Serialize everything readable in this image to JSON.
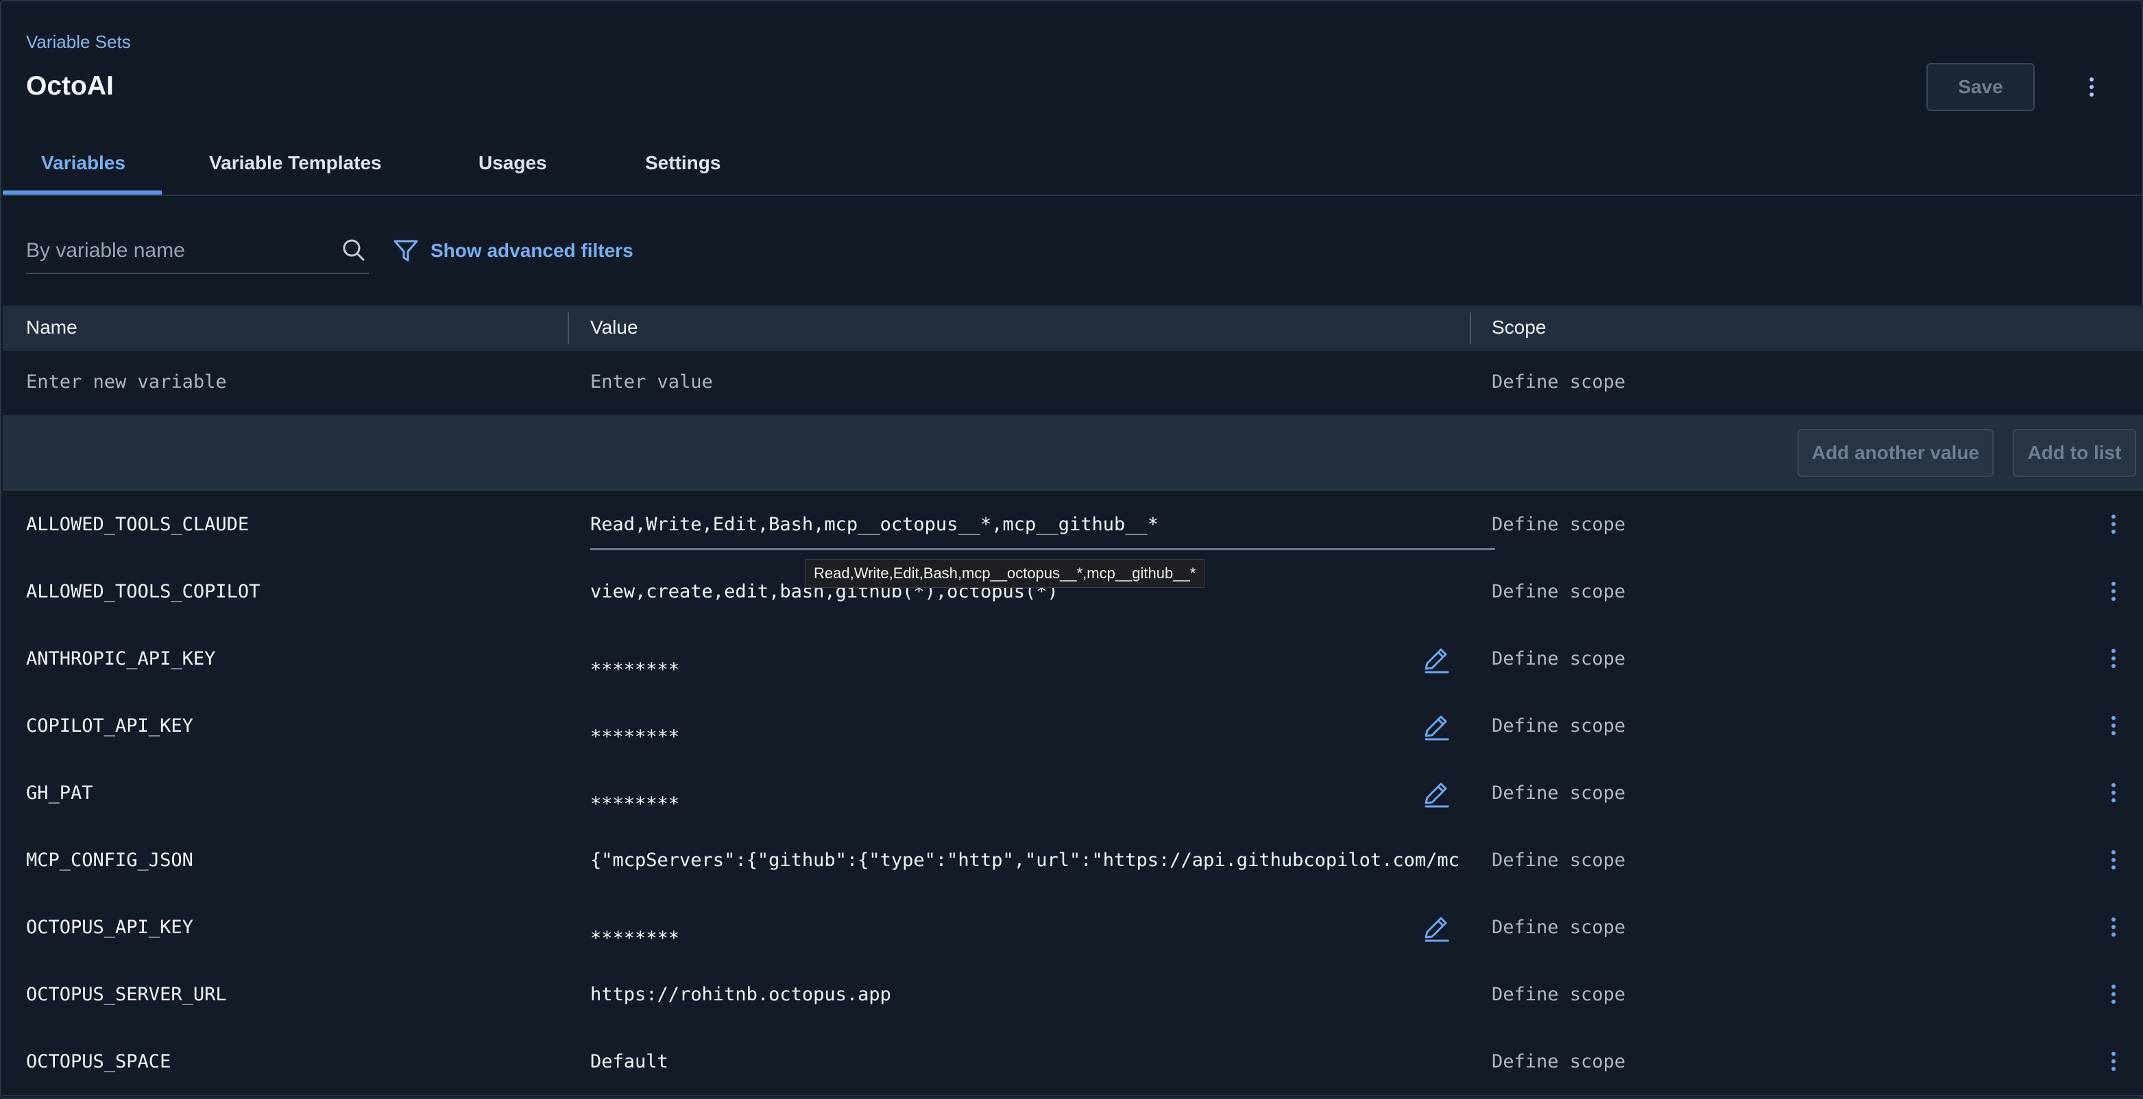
{
  "breadcrumb": "Variable Sets",
  "title": "OctoAI",
  "header": {
    "save_label": "Save",
    "more_icon": "more-vertical-icon"
  },
  "tabs": [
    {
      "label": "Variables",
      "active": true
    },
    {
      "label": "Variable Templates",
      "active": false
    },
    {
      "label": "Usages",
      "active": false
    },
    {
      "label": "Settings",
      "active": false
    }
  ],
  "filters": {
    "search_placeholder": "By variable name",
    "search_value": "",
    "advanced_label": "Show advanced filters"
  },
  "table": {
    "columns": [
      "Name",
      "Value",
      "Scope"
    ],
    "new_row": {
      "name_placeholder": "Enter new variable",
      "value_placeholder": "Enter value",
      "scope_placeholder": "Define scope"
    },
    "add_another_label": "Add another value",
    "add_to_list_label": "Add to list",
    "rows": [
      {
        "name": "ALLOWED_TOOLS_CLAUDE",
        "value": "Read,Write,Edit,Bash,mcp__octopus__*,mcp__github__*",
        "scope": "Define scope",
        "sensitive": false
      },
      {
        "name": "ALLOWED_TOOLS_COPILOT",
        "value": "view,create,edit,bash,github(*),octopus(*)",
        "scope": "Define scope",
        "sensitive": false
      },
      {
        "name": "ANTHROPIC_API_KEY",
        "value": "********",
        "scope": "Define scope",
        "sensitive": true
      },
      {
        "name": "COPILOT_API_KEY",
        "value": "********",
        "scope": "Define scope",
        "sensitive": true
      },
      {
        "name": "GH_PAT",
        "value": "********",
        "scope": "Define scope",
        "sensitive": true
      },
      {
        "name": "MCP_CONFIG_JSON",
        "value": "{\"mcpServers\":{\"github\":{\"type\":\"http\",\"url\":\"https://api.githubcopilot.com/mc",
        "scope": "Define scope",
        "sensitive": false
      },
      {
        "name": "OCTOPUS_API_KEY",
        "value": "********",
        "scope": "Define scope",
        "sensitive": true
      },
      {
        "name": "OCTOPUS_SERVER_URL",
        "value": "https://rohitnb.octopus.app",
        "scope": "Define scope",
        "sensitive": false
      },
      {
        "name": "OCTOPUS_SPACE",
        "value": "Default",
        "scope": "Define scope",
        "sensitive": false
      }
    ]
  },
  "tooltip": "Read,Write,Edit,Bash,mcp__octopus__*,mcp__github__*",
  "colors": {
    "accent": "#78aef0",
    "background": "#111a26"
  }
}
